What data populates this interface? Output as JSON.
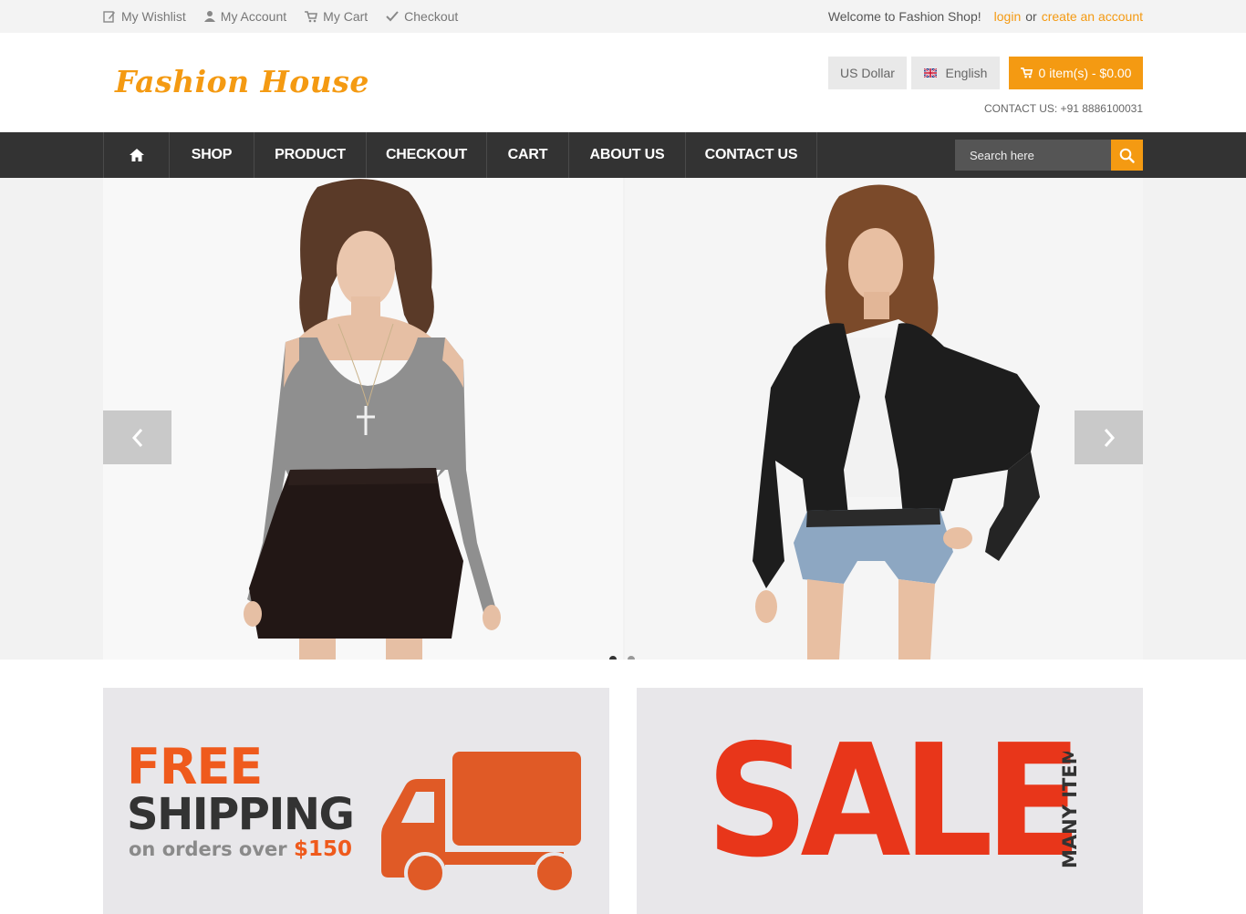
{
  "topbar": {
    "links": [
      {
        "label": "My Wishlist",
        "icon": "edit-icon"
      },
      {
        "label": "My Account",
        "icon": "user-icon"
      },
      {
        "label": "My Cart",
        "icon": "cart-icon"
      },
      {
        "label": "Checkout",
        "icon": "check-icon"
      }
    ],
    "welcome": "Welcome to Fashion Shop!",
    "login": "login",
    "or": "or",
    "create": "create an account"
  },
  "header": {
    "logo": "Fashion House",
    "currency": "US Dollar",
    "language": "English",
    "cart": "0 item(s) - $0.00",
    "contact": "CONTACT US: +91 8886100031"
  },
  "nav": {
    "items": [
      "SHOP",
      "PRODUCT",
      "CHECKOUT",
      "CART",
      "ABOUT US",
      "CONTACT US"
    ],
    "search_placeholder": "Search here"
  },
  "slider": {
    "slide_count": 2,
    "active_slide": 1
  },
  "banners": {
    "shipping": {
      "line1": "FREE",
      "line2": "SHIPPING",
      "line3": "on orders over",
      "amount": "$150"
    },
    "sale": {
      "title": "SALE",
      "subtitle": "MANY ITEMS"
    }
  },
  "colors": {
    "accent": "#f49a12",
    "nav": "#333333",
    "shipping_orange": "#ef5a1c",
    "sale_red": "#e8361a"
  }
}
